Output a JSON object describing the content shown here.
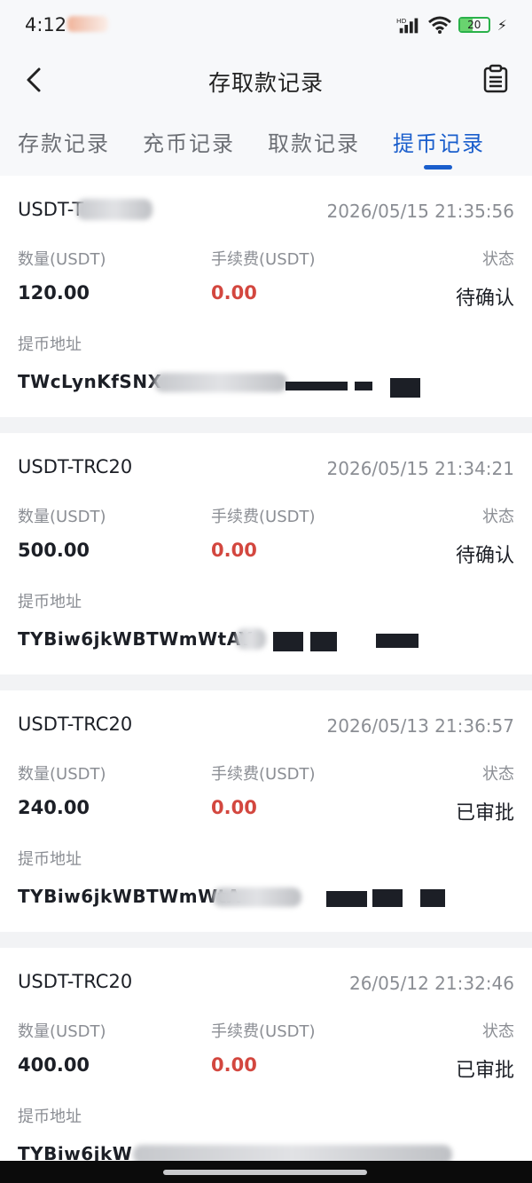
{
  "status_bar": {
    "time": "4:12",
    "battery": "20"
  },
  "nav": {
    "title": "存取款记录"
  },
  "tabs": [
    {
      "label": "存款记录",
      "active": false
    },
    {
      "label": "充币记录",
      "active": false
    },
    {
      "label": "取款记录",
      "active": false
    },
    {
      "label": "提币记录",
      "active": true
    }
  ],
  "labels": {
    "amount": "数量(USDT)",
    "fee": "手续费(USDT)",
    "status": "状态",
    "address": "提币地址"
  },
  "records": [
    {
      "network": "USDT-T",
      "time": "2026/05/15 21:35:56",
      "amount": "120.00",
      "fee": "0.00",
      "status": "待确认",
      "address": "TWcLynKfSNX"
    },
    {
      "network": "USDT-TRC20",
      "time": "2026/05/15 21:34:21",
      "amount": "500.00",
      "fee": "0.00",
      "status": "待确认",
      "address": "TYBiw6jkWBTWmWtAY"
    },
    {
      "network": "USDT-TRC20",
      "time": "2026/05/13 21:36:57",
      "amount": "240.00",
      "fee": "0.00",
      "status": "已审批",
      "address": "TYBiw6jkWBTWmWtA"
    },
    {
      "network": "USDT-TRC20",
      "time": "26/05/12 21:32:46",
      "amount": "400.00",
      "fee": "0.00",
      "status": "已审批",
      "address": "TYBiw6jkW"
    }
  ],
  "colors": {
    "accent": "#1a5ecc",
    "fee": "#d3473f",
    "battery": "#2ab14a"
  }
}
